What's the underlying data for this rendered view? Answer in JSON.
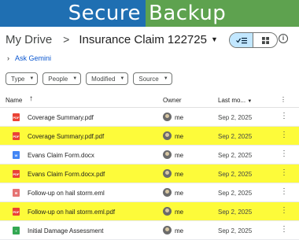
{
  "banner": {
    "left": "Secure",
    "right": "Backup"
  },
  "breadcrumb": {
    "root": "My Drive",
    "separator": ">",
    "current": "Insurance Claim 122725"
  },
  "gemini": {
    "label": "Ask Gemini"
  },
  "filters": [
    "Type",
    "People",
    "Modified",
    "Source"
  ],
  "table": {
    "headers": {
      "name": "Name",
      "owner": "Owner",
      "last_modified": "Last mo..."
    },
    "rows": [
      {
        "icon": "pdf-icon",
        "name": "Coverage Summary.pdf",
        "owner": "me",
        "date": "Sep 2, 2025",
        "highlighted": false
      },
      {
        "icon": "pdf-icon",
        "name": "Coverage Summary.pdf.pdf",
        "owner": "me",
        "date": "Sep 2, 2025",
        "highlighted": true
      },
      {
        "icon": "doc-icon",
        "name": "Evans Claim Form.docx",
        "owner": "me",
        "date": "Sep 2, 2025",
        "highlighted": false
      },
      {
        "icon": "pdf-icon",
        "name": "Evans Claim Form.docx.pdf",
        "owner": "me",
        "date": "Sep 2, 2025",
        "highlighted": true
      },
      {
        "icon": "eml-icon",
        "name": "Follow-up on hail storm.eml",
        "owner": "me",
        "date": "Sep 2, 2025",
        "highlighted": false
      },
      {
        "icon": "pdf-icon",
        "name": "Follow-up on hail storm.eml.pdf",
        "owner": "me",
        "date": "Sep 2, 2025",
        "highlighted": true
      },
      {
        "icon": "sheet-icon",
        "name": "Initial Damage Assessment",
        "owner": "me",
        "date": "Sep 2, 2025",
        "highlighted": false
      }
    ]
  },
  "colors": {
    "banner_blue": "#1f6fb2",
    "banner_green": "#5ea24f",
    "highlight": "#fdfb3a",
    "pdf": "#ea4335",
    "doc": "#4285f4",
    "eml": "#e57373",
    "sheet": "#34a853"
  }
}
